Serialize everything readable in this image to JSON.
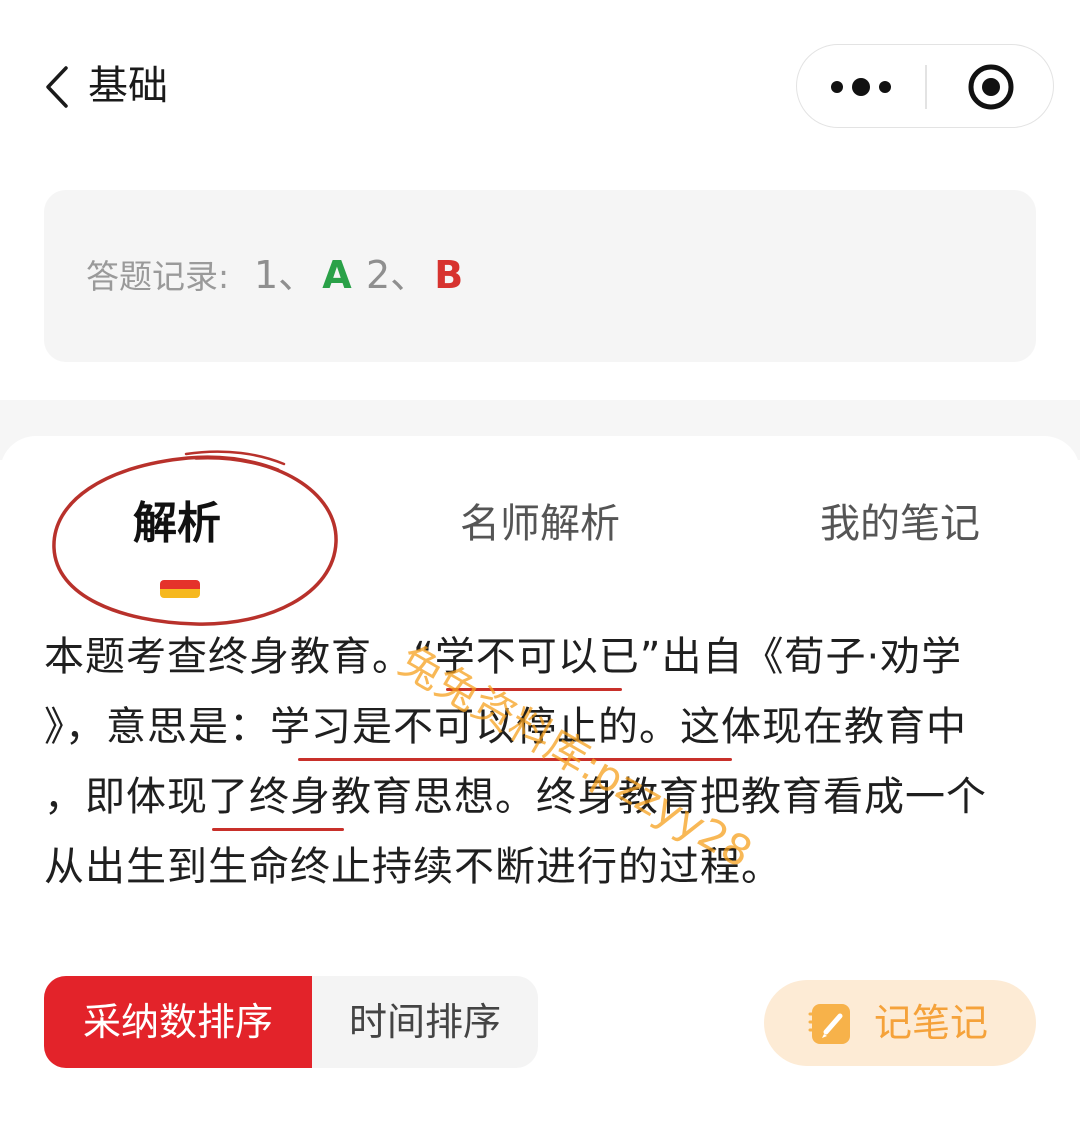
{
  "nav": {
    "back_icon": "chevron-left-icon",
    "title": "基础",
    "more_icon": "more-dots-icon",
    "target_icon": "record-target-icon"
  },
  "record": {
    "label": "答题记录:",
    "items": [
      {
        "num": "1、",
        "answer": "A",
        "color": "#2aa148"
      },
      {
        "num": "2、",
        "answer": "B",
        "color": "#d7332f"
      }
    ]
  },
  "tabs": [
    {
      "label": "解析",
      "active": true
    },
    {
      "label": "名师解析",
      "active": false
    },
    {
      "label": "我的笔记",
      "active": false
    }
  ],
  "content": {
    "line1": "本题考查终身教育。“学不可以已”出自《荀子·劝学",
    "line2": "》，意思是：学习是不可以停止的。这体现在教育中",
    "line3": "，即体现了终身教育思想。终身教育把教育看成一个",
    "line4": "从出生到生命终止持续不断进行的过程。"
  },
  "watermark": "兔兔资料库:pzzyy28",
  "sort": {
    "active_label": "采纳数排序",
    "time_label": "时间排序"
  },
  "note_button": {
    "label": "记笔记",
    "icon": "edit-note-icon"
  },
  "colors": {
    "accent_red": "#e3232a",
    "correct_green": "#2aa148",
    "wrong_red": "#d7332f",
    "note_orange": "#f5a23a"
  }
}
